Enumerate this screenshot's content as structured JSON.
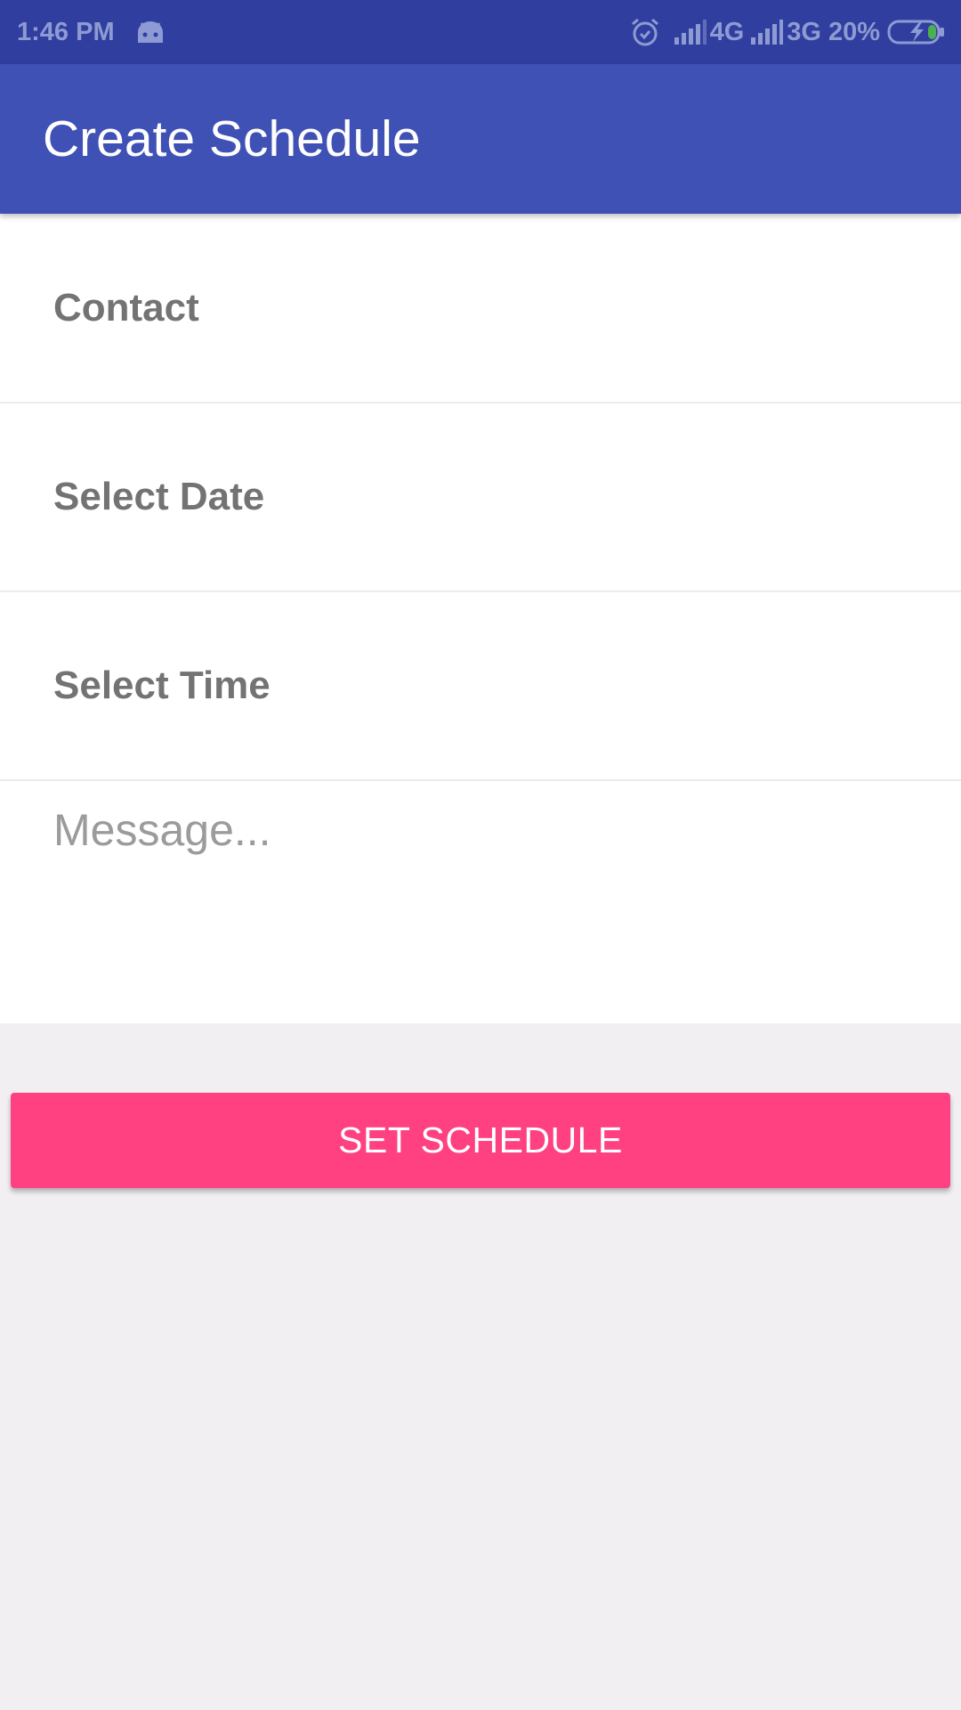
{
  "status_bar": {
    "time": "1:46 PM",
    "network_1": "4G",
    "network_2": "3G",
    "battery": "20%",
    "icons": [
      "android-notification-icon",
      "alarm-icon",
      "signal-icon",
      "signal-icon",
      "battery-charging-icon"
    ],
    "background": "#303f9f",
    "text_color": "#8e9ad3"
  },
  "app_bar": {
    "title": "Create Schedule",
    "background": "#3f51b5"
  },
  "form": {
    "contact_label": "Contact",
    "date_label": "Select Date",
    "time_label": "Select Time",
    "message_placeholder": "Message...",
    "message_value": ""
  },
  "actions": {
    "set_schedule_label": "SET SCHEDULE",
    "accent": "#ff4081"
  }
}
